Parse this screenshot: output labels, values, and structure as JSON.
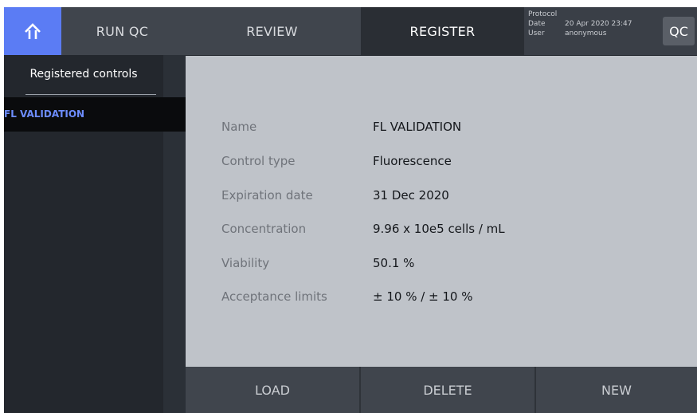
{
  "topbar": {
    "tabs": {
      "run_qc": "RUN QC",
      "review": "REVIEW",
      "register": "REGISTER"
    },
    "info": {
      "protocol_label": "Protocol",
      "date_label": "Date",
      "date_value": "20 Apr 2020 23:47",
      "user_label": "User",
      "user_value": "anonymous"
    },
    "qc_button": "QC",
    "home_icon": "home-arrow-up-icon"
  },
  "sidebar": {
    "title": "Registered controls",
    "items": [
      {
        "label": "FL VALIDATION",
        "selected": true
      }
    ]
  },
  "details": {
    "name_label": "Name",
    "name_value": "FL VALIDATION",
    "control_type_label": "Control type",
    "control_type_value": "Fluorescence",
    "expiration_label": "Expiration date",
    "expiration_value": "31 Dec 2020",
    "concentration_label": "Concentration",
    "concentration_value": "9.96 x 10e5 cells / mL",
    "viability_label": "Viability",
    "viability_value": "50.1 %",
    "acceptance_label": "Acceptance limits",
    "acceptance_value": "± 10 % / ± 10 %"
  },
  "actions": {
    "load": "LOAD",
    "delete": "DELETE",
    "new": "NEW"
  },
  "colors": {
    "accent": "#5b7cf4",
    "selected_text": "#6d8dff",
    "panel_bg": "#bfc3c9"
  }
}
